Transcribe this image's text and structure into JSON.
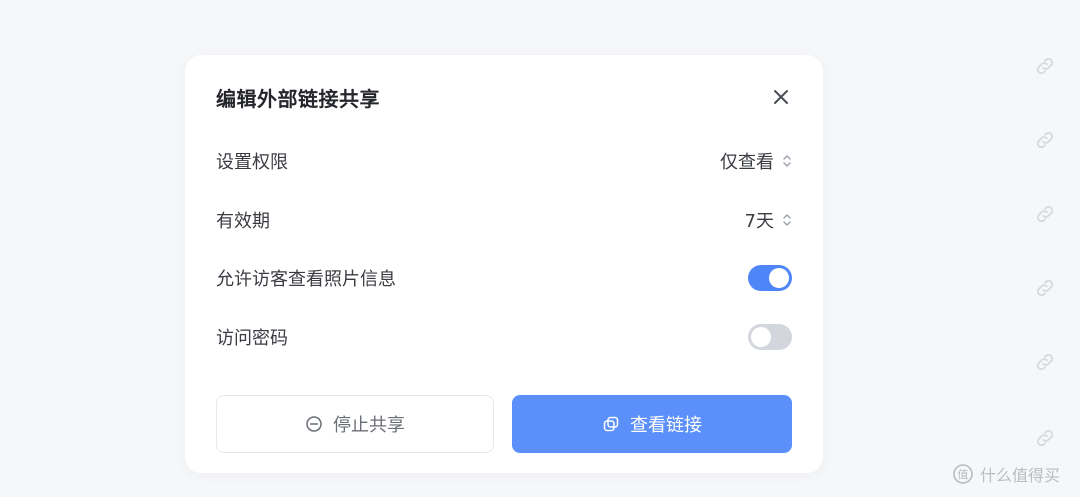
{
  "dialog": {
    "title": "编辑外部链接共享",
    "close_icon": "close-icon"
  },
  "settings": {
    "permission": {
      "label": "设置权限",
      "value": "仅查看"
    },
    "validity": {
      "label": "有效期",
      "value": "7天"
    },
    "allow_photo_info": {
      "label": "允许访客查看照片信息",
      "enabled": true
    },
    "access_password": {
      "label": "访问密码",
      "enabled": false
    }
  },
  "actions": {
    "stop_share_label": "停止共享",
    "view_link_label": "查看链接"
  },
  "background": {
    "link_icon_count": 6
  },
  "watermark": {
    "text": "什么值得买"
  },
  "colors": {
    "accent": "#5b8ff9",
    "toggle_on": "#4f86f7",
    "toggle_off": "#d3d6dc",
    "page_background": "#f6f7f9"
  }
}
